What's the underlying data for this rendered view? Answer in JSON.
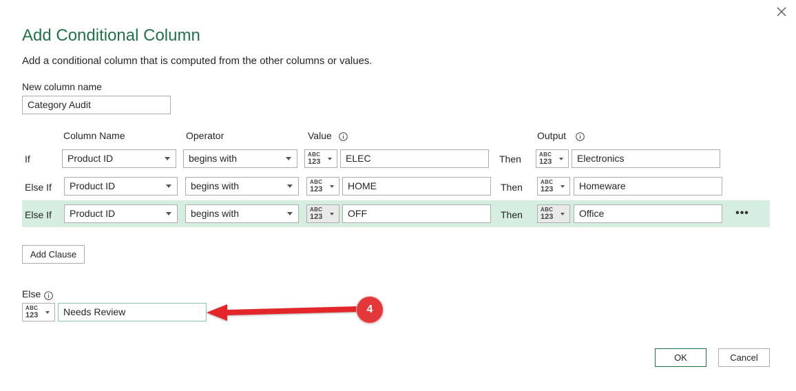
{
  "dialog": {
    "title": "Add Conditional Column",
    "subtitle": "Add a conditional column that is computed from the other columns or values.",
    "new_column_label": "New column name",
    "new_column_value": "Category Audit"
  },
  "headers": {
    "column_name": "Column Name",
    "operator": "Operator",
    "value": "Value",
    "output": "Output"
  },
  "type_icon": {
    "top": "ABC",
    "bottom": "123"
  },
  "clauses": [
    {
      "keyword": "If",
      "column": "Product ID",
      "operator": "begins with",
      "value": "ELEC",
      "then": "Then",
      "output": "Electronics"
    },
    {
      "keyword": "Else If",
      "column": "Product ID",
      "operator": "begins with",
      "value": "HOME",
      "then": "Then",
      "output": "Homeware"
    },
    {
      "keyword": "Else If",
      "column": "Product ID",
      "operator": "begins with",
      "value": "OFF",
      "then": "Then",
      "output": "Office"
    }
  ],
  "more_label": "•••",
  "add_clause_label": "Add Clause",
  "else": {
    "label": "Else",
    "value": "Needs Review"
  },
  "annotation": {
    "number": "4",
    "color": "#e2383a"
  },
  "buttons": {
    "ok": "OK",
    "cancel": "Cancel"
  },
  "colors": {
    "accent": "#217346",
    "row_highlight": "#d6eee0"
  }
}
